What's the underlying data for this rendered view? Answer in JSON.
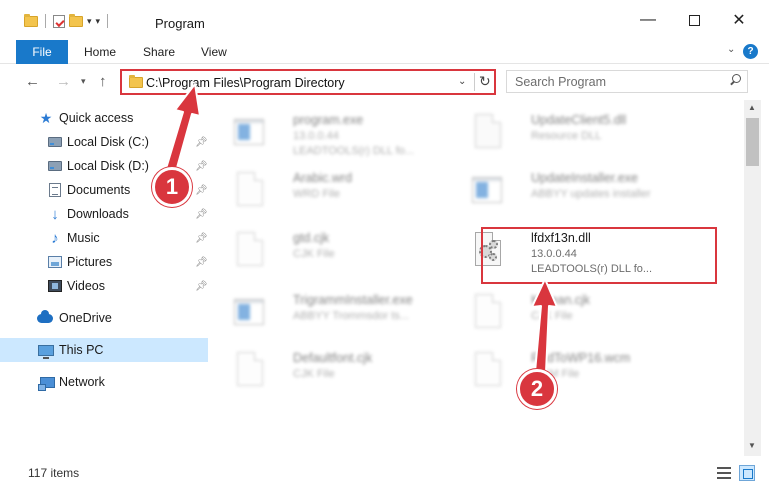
{
  "window": {
    "title": "Program",
    "minimize_symbol": "—",
    "close_symbol": "✕"
  },
  "ribbon": {
    "file_label": "File",
    "tabs": [
      "Home",
      "Share",
      "View"
    ],
    "help_symbol": "?"
  },
  "navigation": {
    "address": "C:\\Program Files\\Program Directory",
    "search_placeholder": "Search Program"
  },
  "sidebar": {
    "items": [
      {
        "label": "Quick access",
        "icon": "star-icon"
      },
      {
        "label": "Local Disk (C:)",
        "icon": "drive-icon",
        "pinned": true
      },
      {
        "label": "Local Disk (D:)",
        "icon": "drive-icon",
        "pinned": true
      },
      {
        "label": "Documents",
        "icon": "documents-icon",
        "pinned": true
      },
      {
        "label": "Downloads",
        "icon": "download-arrow-icon",
        "pinned": true
      },
      {
        "label": "Music",
        "icon": "music-note-icon",
        "pinned": true
      },
      {
        "label": "Pictures",
        "icon": "pictures-icon",
        "pinned": true
      },
      {
        "label": "Videos",
        "icon": "videos-icon",
        "pinned": true
      },
      {
        "label": "OneDrive",
        "icon": "cloud-icon"
      },
      {
        "label": "This PC",
        "icon": "computer-icon",
        "selected": true
      },
      {
        "label": "Network",
        "icon": "network-icon"
      }
    ]
  },
  "files": [
    {
      "name": "program.exe",
      "line1": "13.0.0.44",
      "line2": "LEADTOOLS(r) DLL fo...",
      "icon": "exe-icon"
    },
    {
      "name": "UpdateClient5.dll",
      "line1": "Resource DLL",
      "line2": "",
      "icon": "dll-icon"
    },
    {
      "name": "Arabic.wrd",
      "line1": "WRD File",
      "line2": "",
      "icon": "document-icon"
    },
    {
      "name": "UpdateInstaller.exe",
      "line1": "ABBYY updates installer",
      "line2": "",
      "icon": "exe-icon"
    },
    {
      "name": "gtd.cjk",
      "line1": "CJK File",
      "line2": "",
      "icon": "document-icon"
    },
    {
      "name": "lfdxf13n.dll",
      "line1": "13.0.0.44",
      "line2": "LEADTOOLS(r) DLL fo...",
      "icon": "dll-gear-icon",
      "highlighted": true
    },
    {
      "name": "TrigrammInstaller.exe",
      "line1": "ABBYY Trommsdor ts...",
      "line2": "",
      "icon": "exe-icon"
    },
    {
      "name": "Korean.cjk",
      "line1": "CJK File",
      "line2": "",
      "icon": "document-icon"
    },
    {
      "name": "Defaultfont.cjk",
      "line1": "CJK File",
      "line2": "",
      "icon": "document-icon"
    },
    {
      "name": "RndToWP16.wcm",
      "line1": "WCM File",
      "line2": "",
      "icon": "document-icon"
    }
  ],
  "status": {
    "item_count": "117 items"
  },
  "annotations": {
    "step1": "1",
    "step2": "2",
    "color": "#d9363e"
  },
  "colors": {
    "accent": "#1979ca",
    "selection": "#cce8ff",
    "annotation_red": "#d9363e"
  }
}
